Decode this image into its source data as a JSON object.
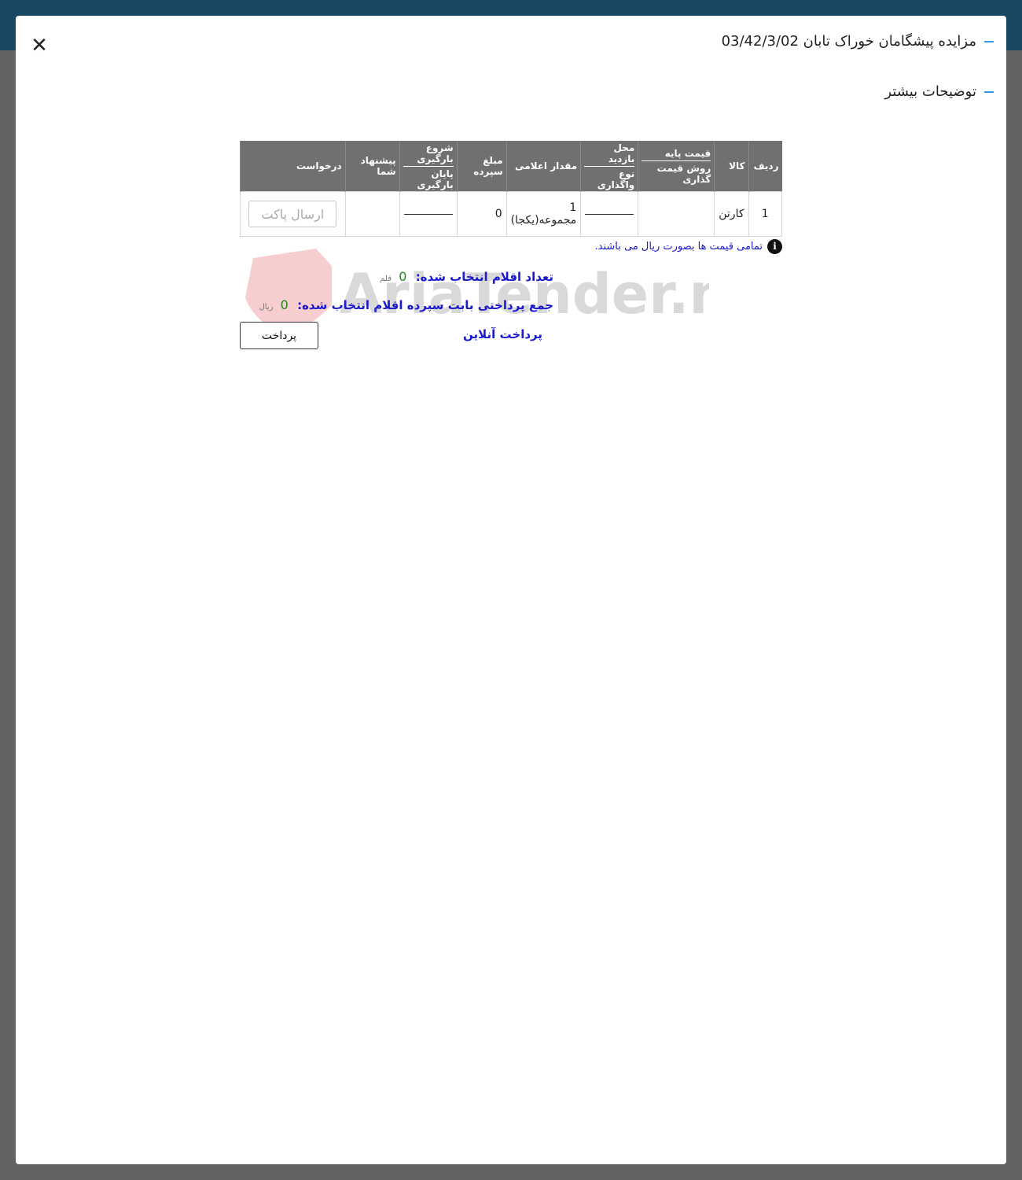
{
  "modal": {
    "title": "مزایده پیشگامان خوراک تابان 03/42/3/02",
    "subtitle": "توضیحات بیشتر",
    "close_icon": "close-icon"
  },
  "table": {
    "headers": {
      "row": "ردیف",
      "item": "کالا",
      "base_price": "قیمت پایه",
      "pricing_method": "روش قیمت گذاری",
      "visit_place": "محل بازدید",
      "assignment_type": "نوع واگذاری",
      "announced_amount": "مقدار اعلامی",
      "deposit": "مبلغ سپرده",
      "loading_start": "شروع بارگیری",
      "loading_end": "پایان بارگیری",
      "your_offer": "پیشنهاد شما",
      "request": "درخواست"
    },
    "rows": [
      {
        "row": "1",
        "item": "کارتن",
        "amount_qty": "1",
        "amount_unit": "مجموعه(یکجا)",
        "deposit": "0",
        "packet_button": "ارسال پاکت"
      }
    ]
  },
  "note": {
    "icon": "info-icon",
    "text": "تمامی قیمت ها بصورت ریال می باشند."
  },
  "summary": {
    "selected_label": "تعداد اقلام انتخاب شده:",
    "selected_count": "0",
    "selected_unit": "قلم",
    "total_label": "جمع پرداختی بابت سپرده اقلام انتخاب شده:",
    "total_value": "0",
    "total_unit": "ریال",
    "online_payment": "پرداخت آنلاین",
    "pay_button": "پرداخت"
  },
  "watermark": {
    "text": "AriaTender.neT"
  },
  "colors": {
    "topbar": "#1a4762",
    "accent": "#2f9ae0",
    "link": "#1a1ad0",
    "number": "#1a8a1a"
  }
}
